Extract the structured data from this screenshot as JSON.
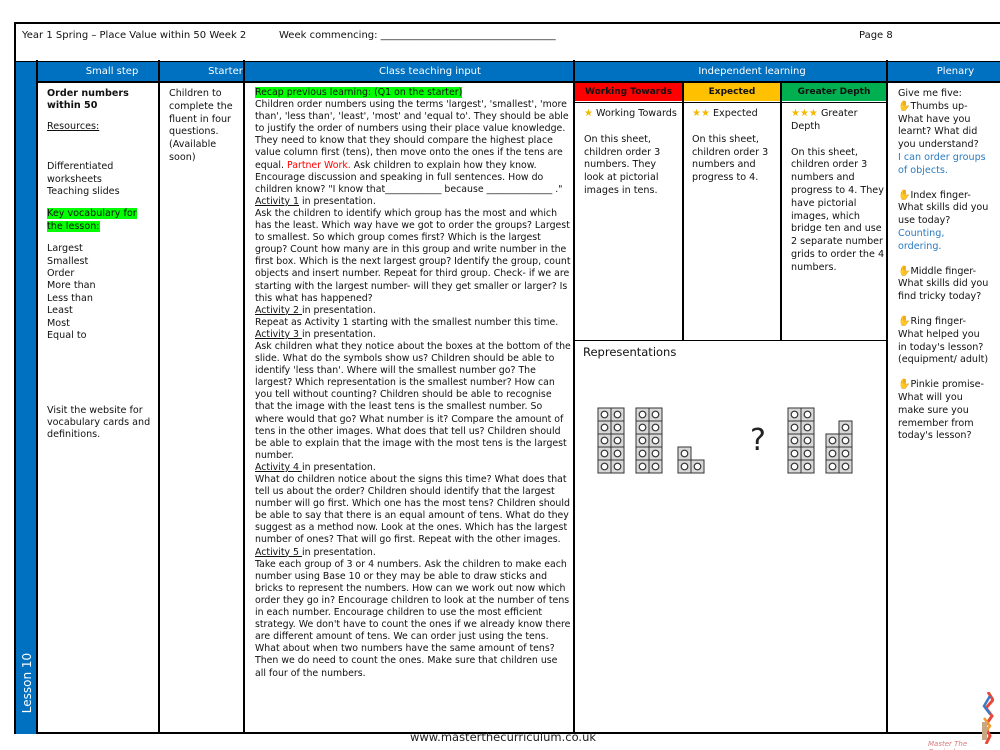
{
  "header": {
    "title": "Year 1 Spring – Place Value within 50 Week  2",
    "week_commencing": "Week commencing: ___________________________________",
    "page": "Page 8"
  },
  "lesson_label": "Lesson 10",
  "columns": {
    "small_step": "Small step",
    "starter": "Starter",
    "class_teaching": "Class teaching input",
    "independent": "Independent learning",
    "plenary": "Plenary"
  },
  "small_step": {
    "title": "Order numbers within 50",
    "resources_label": "Resources:",
    "resources": [
      "Differentiated",
      "worksheets",
      "Teaching slides"
    ],
    "vocab_label": "Key vocabulary for the lesson:",
    "vocab": [
      "Largest",
      "Smallest",
      "Order",
      "More than",
      "Less than",
      "Least",
      "Most",
      "Equal to"
    ],
    "visit_note": "Visit the website for vocabulary cards and definitions."
  },
  "starter": {
    "text": "Children to complete the fluent in four questions. (Available soon)"
  },
  "teaching": {
    "recap": "Recap previous learning: (Q1 on the starter)",
    "intro": "Children order numbers using the terms 'largest', 'smallest', 'more than', 'less than', 'least', 'most' and 'equal to'. They should be able to justify the order of numbers using their place value knowledge. They need to know that they should compare the highest place value column first (tens), then move onto the ones if the tens are equal.",
    "partner_label": "Partner Work.",
    "partner_text": " Ask children to explain how they know. Encourage discussion and speaking in full sentences. How do children know?  \"I know that____________ because ______________ .\"",
    "activities": [
      {
        "label": "Activity 1",
        "suffix": " in presentation.",
        "text": "Ask the children to identify which group has the most  and which has the least. Which way have we got to order the groups? Largest to smallest. So which group comes first? Which is the largest group? Count how many are in this group and write number in the first box. Which is the next largest group? Identify the group, count objects and insert number. Repeat for third group. Check- if we are starting with the largest number- will they get smaller or larger? Is this what has happened?"
      },
      {
        "label": "Activity 2 ",
        "suffix": "in presentation.",
        "text": "Repeat as Activity 1 starting with the smallest number this time."
      },
      {
        "label": "Activity 3 ",
        "suffix": "in presentation.",
        "text": "Ask children what they notice about the boxes at the bottom of the slide. What do the symbols show us? Children should be able to identify 'less than'. Where will the smallest number go? The largest? Which representation is the smallest number? How can you tell without counting? Children should be able to recognise that the image with the least tens is the smallest number. So where would that go? What number is it? Compare the amount of tens in the other images. What does that tell us? Children should be able to explain that the image with the most tens is the largest number."
      },
      {
        "label": "Activity 4 ",
        "suffix": "in presentation.",
        "text": "What do children notice about the signs this time? What does that tell us about the order? Children should identify that the largest number will go first. Which one has the most tens? Children should be able to say that there is an equal amount of tens. What do they suggest as a method now. Look at the ones. Which has the largest number of ones? That will go first. Repeat with the other images."
      },
      {
        "label": "Activity 5 ",
        "suffix": " in presentation.",
        "text": "Take each group of  3 or 4  numbers. Ask the children to make each number using Base 10  or they may be able to draw sticks and bricks to represent the numbers. How can we work out now which order they go in? Encourage children to look at the number of tens in each number. Encourage children to use the most efficient strategy. We don't have to count the ones if we already know there are different amount of tens. We can order just using the tens. What about when two numbers have the same amount of tens? Then we do need to count the ones. Make sure that children use all four of the numbers."
      }
    ]
  },
  "independent": {
    "levels": [
      {
        "name": "Working Towards",
        "color": "#ff0000",
        "stars": "★",
        "star_title": "Working Towards",
        "text": "On this sheet, children order 3 numbers. They look at pictorial images in tens."
      },
      {
        "name": "Expected",
        "color": "#ffc000",
        "stars": "★★",
        "star_title": "Expected",
        "text": "On this sheet, children order 3 numbers and progress to 4."
      },
      {
        "name": "Greater Depth",
        "color": "#00b050",
        "stars": "★★★",
        "star_title": "Greater Depth",
        "text": "On this sheet, children order 3 numbers and progress to 4. They have pictorial images, which bridge ten and use 2 separate number grids to order the 4 numbers."
      }
    ],
    "representations_title": "Representations",
    "representation_question": "?",
    "representation_left": {
      "tens": 2,
      "ones": 3
    },
    "representation_right": {
      "tens": 1,
      "ones": 7
    }
  },
  "plenary": {
    "intro": "Give me five:",
    "items": [
      {
        "lead": "Thumbs up-",
        "text": "What have you learnt? What did you understand?",
        "answer": "I can order groups of objects."
      },
      {
        "lead": "Index finger-",
        "text": "What skills did you use today?",
        "answer": "Counting, ordering."
      },
      {
        "lead": "Middle finger-",
        "text": "What skills did you find tricky today?",
        "answer": ""
      },
      {
        "lead": "Ring finger-",
        "text": "What helped you in today's lesson? (equipment/ adult)",
        "answer": ""
      },
      {
        "lead": "Pinkie promise-",
        "text": "What will you make sure you remember from today's lesson?",
        "answer": ""
      }
    ]
  },
  "footer": {
    "url": "www.masterthecurriculum.co.uk",
    "logo_text": "Master The Curriculum"
  },
  "colors": {
    "header_blue": "#0070c0",
    "highlight_green": "#00ff00",
    "partner_red": "#ff0000",
    "answer_blue": "#2b7bbf"
  }
}
